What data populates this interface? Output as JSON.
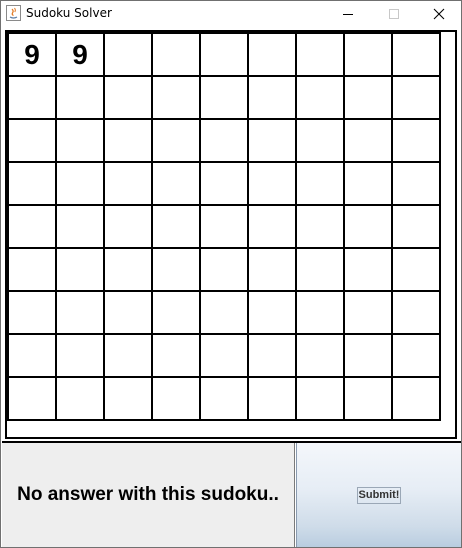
{
  "window": {
    "title": "Sudoku Solver",
    "controls": {
      "minimize_icon": "minimize-icon",
      "maximize_icon": "maximize-icon",
      "close_icon": "close-icon"
    }
  },
  "board": {
    "rows": [
      [
        "9",
        "9",
        "",
        "",
        "",
        "",
        "",
        "",
        ""
      ],
      [
        "",
        "",
        "",
        "",
        "",
        "",
        "",
        "",
        ""
      ],
      [
        "",
        "",
        "",
        "",
        "",
        "",
        "",
        "",
        ""
      ],
      [
        "",
        "",
        "",
        "",
        "",
        "",
        "",
        "",
        ""
      ],
      [
        "",
        "",
        "",
        "",
        "",
        "",
        "",
        "",
        ""
      ],
      [
        "",
        "",
        "",
        "",
        "",
        "",
        "",
        "",
        ""
      ],
      [
        "",
        "",
        "",
        "",
        "",
        "",
        "",
        "",
        ""
      ],
      [
        "",
        "",
        "",
        "",
        "",
        "",
        "",
        "",
        ""
      ],
      [
        "",
        "",
        "",
        "",
        "",
        "",
        "",
        "",
        ""
      ]
    ]
  },
  "status": {
    "message": "No answer with this sudoku.."
  },
  "actions": {
    "submit_label": "Submit!"
  }
}
